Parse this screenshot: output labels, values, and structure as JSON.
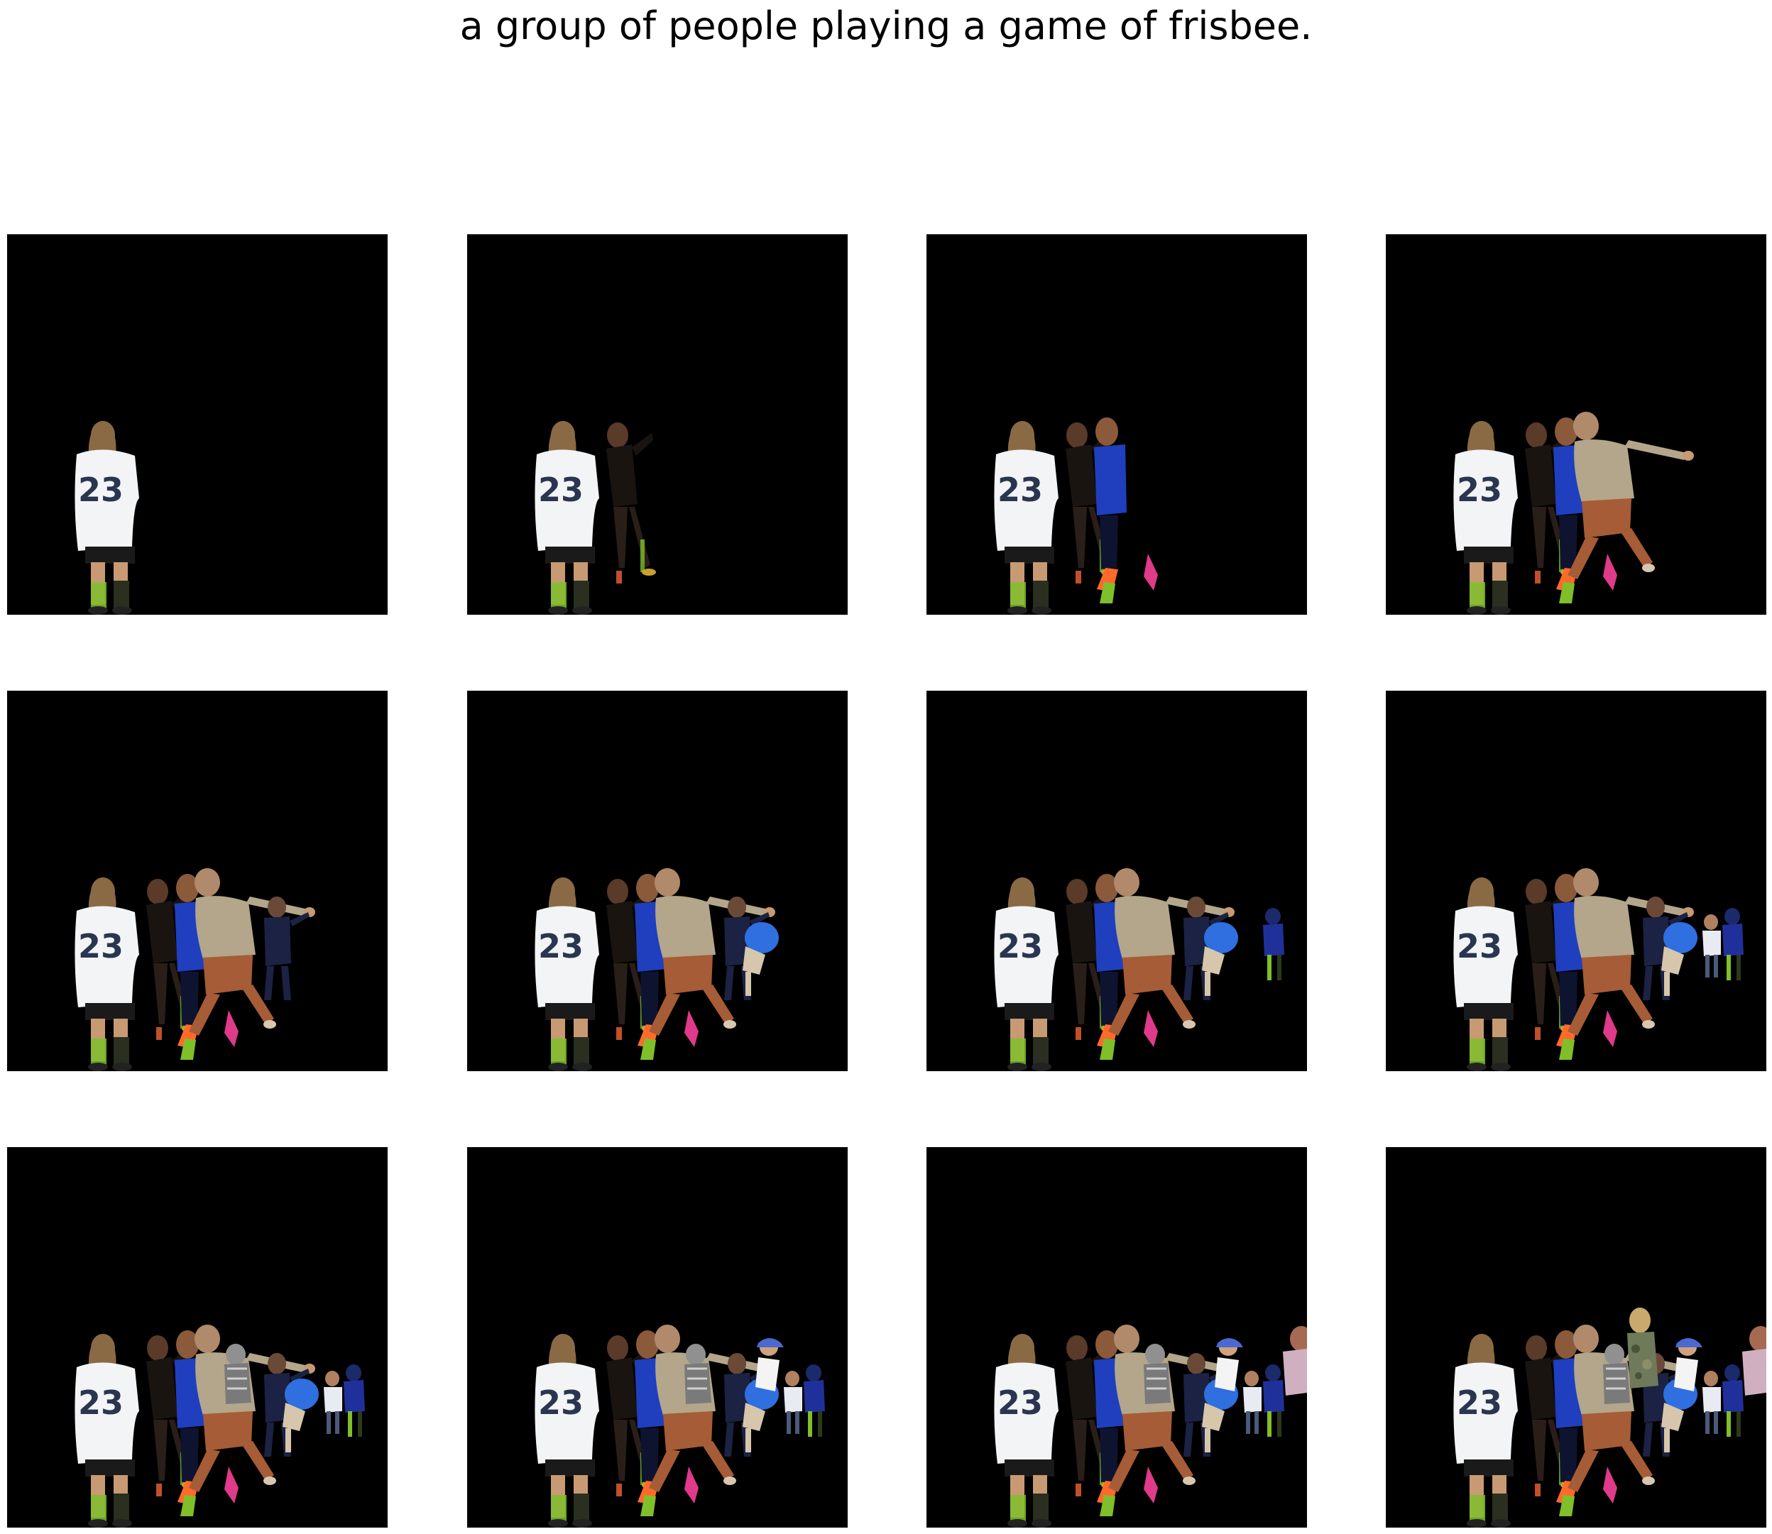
{
  "caption": "a group of people playing a game of frisbee.",
  "frames": [
    {
      "people": [
        "p23"
      ]
    },
    {
      "people": [
        "p23",
        "pdark"
      ]
    },
    {
      "people": [
        "p23",
        "pdark",
        "pblue"
      ]
    },
    {
      "people": [
        "p23",
        "pdark",
        "pblue",
        "ptan"
      ]
    },
    {
      "people": [
        "p23",
        "pdark",
        "pblue",
        "ptan",
        "pnavy"
      ]
    },
    {
      "people": [
        "p23",
        "pdark",
        "pblue",
        "ptan",
        "pnavy",
        "pball"
      ]
    },
    {
      "people": [
        "p23",
        "pdark",
        "pblue",
        "ptan",
        "pnavy",
        "pball",
        "pfar"
      ]
    },
    {
      "people": [
        "p23",
        "pdark",
        "pblue",
        "ptan",
        "pnavy",
        "pball",
        "pfar",
        "pwhite"
      ]
    },
    {
      "people": [
        "p23",
        "pdark",
        "pblue",
        "ptan",
        "pnavy",
        "pball",
        "pfar",
        "pwhite",
        "pgray"
      ]
    },
    {
      "people": [
        "p23",
        "pdark",
        "pblue",
        "ptan",
        "pnavy",
        "pball",
        "pfar",
        "pwhite",
        "pgray",
        "pcap"
      ]
    },
    {
      "people": [
        "p23",
        "pdark",
        "pblue",
        "ptan",
        "pnavy",
        "pball",
        "pfar",
        "pwhite",
        "pgray",
        "pcap",
        "pedge"
      ]
    },
    {
      "people": [
        "p23",
        "pdark",
        "pblue",
        "ptan",
        "pnavy",
        "pball",
        "pfar",
        "pwhite",
        "pgray",
        "pcap",
        "pedge",
        "pcamo"
      ]
    }
  ],
  "jersey_number": "23",
  "colors": {
    "background": "#ffffff",
    "frame": "#000000",
    "jersey": "#f2f4f6",
    "jersey_number": "#2a3550",
    "skin": "#c79a73",
    "hair": "#8a6a45",
    "blue_shirt": "#1f3fbf",
    "tan_shirt": "#b3a68a",
    "orange_shorts": "#a65c36",
    "navy": "#1c2244",
    "neon": "#7fbf2a",
    "ball_blue": "#2f6fe0"
  }
}
